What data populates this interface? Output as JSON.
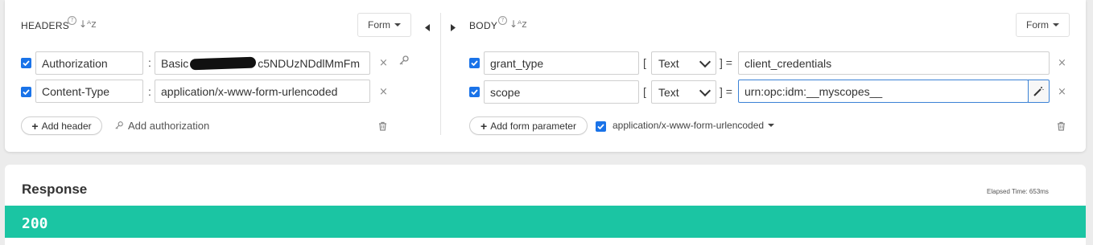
{
  "headers": {
    "title": "HEADERS",
    "form_label": "Form",
    "rows": [
      {
        "key": "Authorization",
        "value": "Basic",
        "value_tail": "c5NDUzNDdlMmFm"
      },
      {
        "key": "Content-Type",
        "value": "application/x-www-form-urlencoded"
      }
    ],
    "add_header_label": "Add header",
    "add_authorization_label": "Add authorization"
  },
  "body": {
    "title": "BODY",
    "form_label": "Form",
    "rows": [
      {
        "key": "grant_type",
        "type": "Text",
        "value": "client_credentials"
      },
      {
        "key": "scope",
        "type": "Text",
        "value": "urn:opc:idm:__myscopes__"
      }
    ],
    "add_form_param_label": "Add form parameter",
    "content_type_label": "application/x-www-form-urlencoded"
  },
  "response": {
    "title": "Response",
    "elapsed_label": "Elapsed Time: 653ms",
    "status_code": "200",
    "status_color": "#1bc5a3"
  },
  "icons": [
    "help-icon",
    "sort-icon",
    "remove-icon",
    "key-icon",
    "trash-icon",
    "magic-wand-icon",
    "collapse-left-icon",
    "expand-right-icon"
  ]
}
